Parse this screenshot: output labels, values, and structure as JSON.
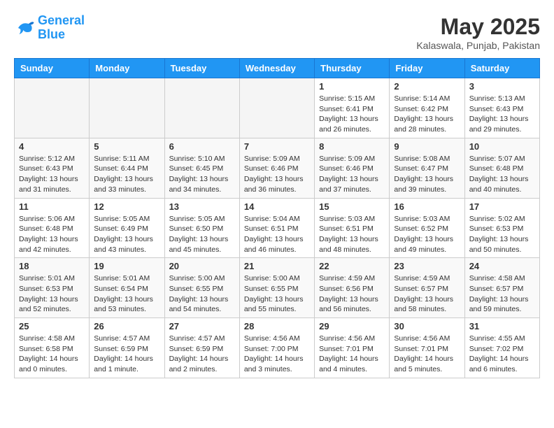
{
  "logo": {
    "line1": "General",
    "line2": "Blue"
  },
  "title": "May 2025",
  "location": "Kalaswala, Punjab, Pakistan",
  "days_of_week": [
    "Sunday",
    "Monday",
    "Tuesday",
    "Wednesday",
    "Thursday",
    "Friday",
    "Saturday"
  ],
  "weeks": [
    [
      {
        "day": "",
        "info": ""
      },
      {
        "day": "",
        "info": ""
      },
      {
        "day": "",
        "info": ""
      },
      {
        "day": "",
        "info": ""
      },
      {
        "day": "1",
        "info": "Sunrise: 5:15 AM\nSunset: 6:41 PM\nDaylight: 13 hours\nand 26 minutes."
      },
      {
        "day": "2",
        "info": "Sunrise: 5:14 AM\nSunset: 6:42 PM\nDaylight: 13 hours\nand 28 minutes."
      },
      {
        "day": "3",
        "info": "Sunrise: 5:13 AM\nSunset: 6:43 PM\nDaylight: 13 hours\nand 29 minutes."
      }
    ],
    [
      {
        "day": "4",
        "info": "Sunrise: 5:12 AM\nSunset: 6:43 PM\nDaylight: 13 hours\nand 31 minutes."
      },
      {
        "day": "5",
        "info": "Sunrise: 5:11 AM\nSunset: 6:44 PM\nDaylight: 13 hours\nand 33 minutes."
      },
      {
        "day": "6",
        "info": "Sunrise: 5:10 AM\nSunset: 6:45 PM\nDaylight: 13 hours\nand 34 minutes."
      },
      {
        "day": "7",
        "info": "Sunrise: 5:09 AM\nSunset: 6:46 PM\nDaylight: 13 hours\nand 36 minutes."
      },
      {
        "day": "8",
        "info": "Sunrise: 5:09 AM\nSunset: 6:46 PM\nDaylight: 13 hours\nand 37 minutes."
      },
      {
        "day": "9",
        "info": "Sunrise: 5:08 AM\nSunset: 6:47 PM\nDaylight: 13 hours\nand 39 minutes."
      },
      {
        "day": "10",
        "info": "Sunrise: 5:07 AM\nSunset: 6:48 PM\nDaylight: 13 hours\nand 40 minutes."
      }
    ],
    [
      {
        "day": "11",
        "info": "Sunrise: 5:06 AM\nSunset: 6:48 PM\nDaylight: 13 hours\nand 42 minutes."
      },
      {
        "day": "12",
        "info": "Sunrise: 5:05 AM\nSunset: 6:49 PM\nDaylight: 13 hours\nand 43 minutes."
      },
      {
        "day": "13",
        "info": "Sunrise: 5:05 AM\nSunset: 6:50 PM\nDaylight: 13 hours\nand 45 minutes."
      },
      {
        "day": "14",
        "info": "Sunrise: 5:04 AM\nSunset: 6:51 PM\nDaylight: 13 hours\nand 46 minutes."
      },
      {
        "day": "15",
        "info": "Sunrise: 5:03 AM\nSunset: 6:51 PM\nDaylight: 13 hours\nand 48 minutes."
      },
      {
        "day": "16",
        "info": "Sunrise: 5:03 AM\nSunset: 6:52 PM\nDaylight: 13 hours\nand 49 minutes."
      },
      {
        "day": "17",
        "info": "Sunrise: 5:02 AM\nSunset: 6:53 PM\nDaylight: 13 hours\nand 50 minutes."
      }
    ],
    [
      {
        "day": "18",
        "info": "Sunrise: 5:01 AM\nSunset: 6:53 PM\nDaylight: 13 hours\nand 52 minutes."
      },
      {
        "day": "19",
        "info": "Sunrise: 5:01 AM\nSunset: 6:54 PM\nDaylight: 13 hours\nand 53 minutes."
      },
      {
        "day": "20",
        "info": "Sunrise: 5:00 AM\nSunset: 6:55 PM\nDaylight: 13 hours\nand 54 minutes."
      },
      {
        "day": "21",
        "info": "Sunrise: 5:00 AM\nSunset: 6:55 PM\nDaylight: 13 hours\nand 55 minutes."
      },
      {
        "day": "22",
        "info": "Sunrise: 4:59 AM\nSunset: 6:56 PM\nDaylight: 13 hours\nand 56 minutes."
      },
      {
        "day": "23",
        "info": "Sunrise: 4:59 AM\nSunset: 6:57 PM\nDaylight: 13 hours\nand 58 minutes."
      },
      {
        "day": "24",
        "info": "Sunrise: 4:58 AM\nSunset: 6:57 PM\nDaylight: 13 hours\nand 59 minutes."
      }
    ],
    [
      {
        "day": "25",
        "info": "Sunrise: 4:58 AM\nSunset: 6:58 PM\nDaylight: 14 hours\nand 0 minutes."
      },
      {
        "day": "26",
        "info": "Sunrise: 4:57 AM\nSunset: 6:59 PM\nDaylight: 14 hours\nand 1 minute."
      },
      {
        "day": "27",
        "info": "Sunrise: 4:57 AM\nSunset: 6:59 PM\nDaylight: 14 hours\nand 2 minutes."
      },
      {
        "day": "28",
        "info": "Sunrise: 4:56 AM\nSunset: 7:00 PM\nDaylight: 14 hours\nand 3 minutes."
      },
      {
        "day": "29",
        "info": "Sunrise: 4:56 AM\nSunset: 7:01 PM\nDaylight: 14 hours\nand 4 minutes."
      },
      {
        "day": "30",
        "info": "Sunrise: 4:56 AM\nSunset: 7:01 PM\nDaylight: 14 hours\nand 5 minutes."
      },
      {
        "day": "31",
        "info": "Sunrise: 4:55 AM\nSunset: 7:02 PM\nDaylight: 14 hours\nand 6 minutes."
      }
    ]
  ]
}
